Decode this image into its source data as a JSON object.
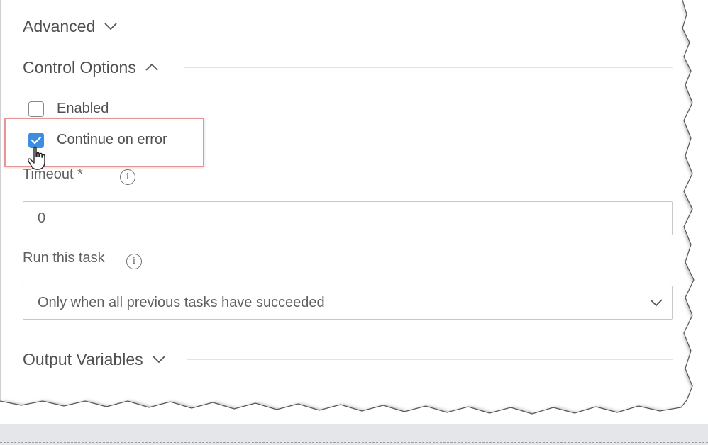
{
  "sections": {
    "advanced": {
      "title": "Advanced",
      "state": "collapsed"
    },
    "control_options": {
      "title": "Control Options",
      "state": "expanded"
    },
    "output_variables": {
      "title": "Output Variables",
      "state": "collapsed"
    }
  },
  "control_options": {
    "enabled": {
      "label": "Enabled",
      "checked": false
    },
    "continue_on_error": {
      "label": "Continue on error",
      "checked": true
    },
    "timeout": {
      "label": "Timeout *",
      "value": "0"
    },
    "run_this_task": {
      "label": "Run this task",
      "selected": "Only when all previous tasks have succeeded"
    }
  },
  "icons": {
    "info": "i"
  },
  "colors": {
    "accent": "#3c8ee0",
    "highlight": "#e69596"
  }
}
